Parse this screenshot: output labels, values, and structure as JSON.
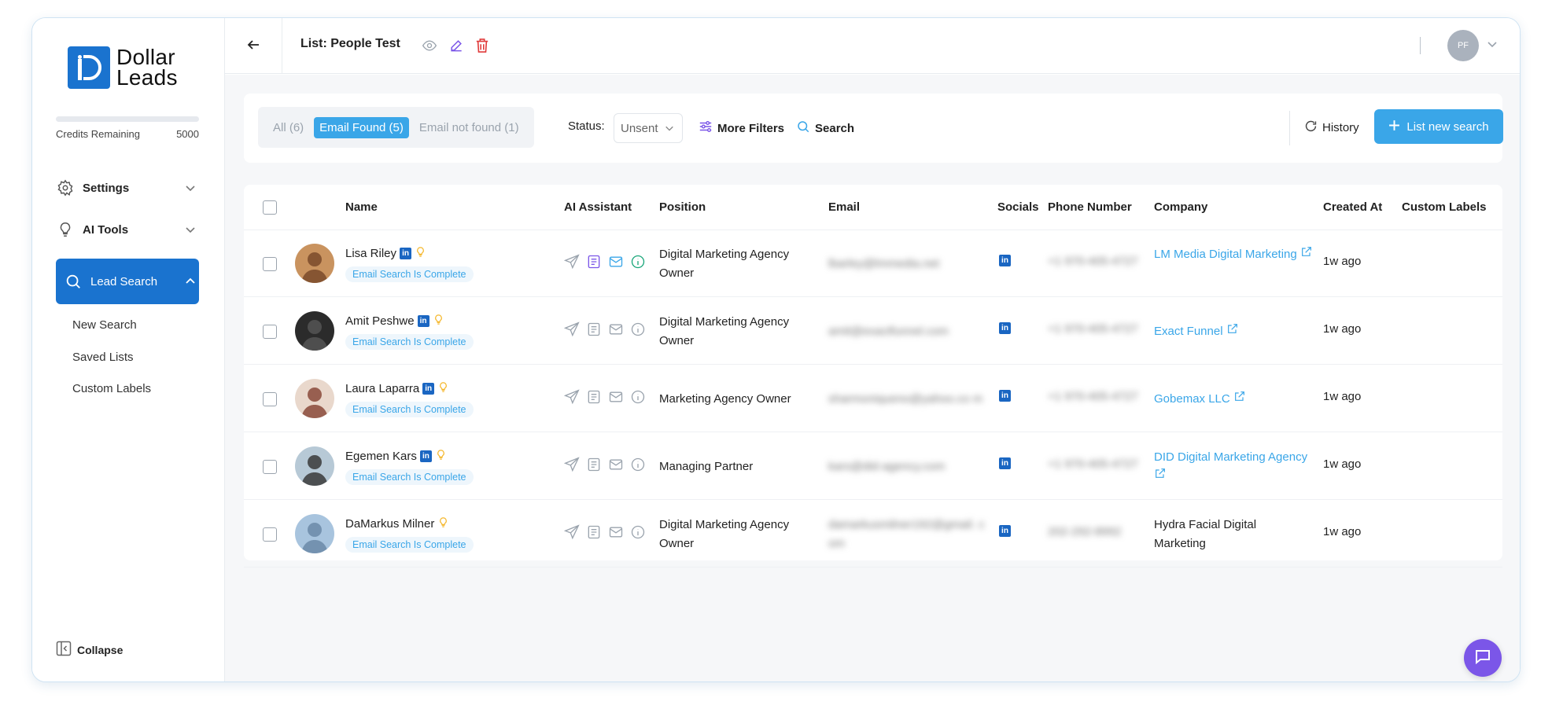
{
  "sidebar": {
    "logo_line1": "Dollar",
    "logo_line2": "Leads",
    "credits_label": "Credits Remaining",
    "credits_value": "5000",
    "settings_label": "Settings",
    "ai_tools_label": "AI Tools",
    "lead_search_label": "Lead Search",
    "sub_items": [
      "New Search",
      "Saved Lists",
      "Custom Labels"
    ],
    "collapse_label": "Collapse"
  },
  "topbar": {
    "title": "List: People Test",
    "avatar_initials": "PF"
  },
  "filters": {
    "tabs": [
      "All (6)",
      "Email Found (5)",
      "Email not found (1)"
    ],
    "active_tab": "Email Found (5)",
    "status_label": "Status:",
    "status_value": "Unsent",
    "more_filters_label": "More Filters",
    "search_label": "Search",
    "history_label": "History",
    "new_search_label": "List new search"
  },
  "table": {
    "columns": [
      "Name",
      "AI Assistant",
      "Position",
      "Email",
      "Socials",
      "Phone Number",
      "Company",
      "Created At",
      "Custom Labels"
    ],
    "rows": [
      {
        "name": "Lisa Riley",
        "has_linkedin": true,
        "status": "Email Search Is Complete",
        "position_line1": "Digital Marketing Agency",
        "position_line2": "Owner",
        "email": "lbarley@lmmedia.net",
        "phone": "+1 970-405-4727",
        "company_line1": "LM Media Digital Marketing",
        "company_line2": "",
        "company_link": true,
        "created": "1w ago"
      },
      {
        "name": "Amit Peshwe",
        "has_linkedin": true,
        "status": "Email Search Is Complete",
        "position_line1": "Digital Marketing Agency",
        "position_line2": "Owner",
        "email": "amit@exactfunnel.com",
        "phone": "+1 970-405-4727",
        "company_line1": "Exact Funnel",
        "company_line2": "",
        "company_link": true,
        "created": "1w ago"
      },
      {
        "name": "Laura Laparra",
        "has_linkedin": true,
        "status": "Email Search Is Complete",
        "position_line1": "Marketing Agency Owner",
        "position_line2": "",
        "email": "sharmoniqueno@yahoo.co m",
        "phone": "+1 970-405-4727",
        "company_line1": "Gobemax LLC",
        "company_line2": "",
        "company_link": true,
        "created": "1w ago"
      },
      {
        "name": "Egemen Kars",
        "has_linkedin": true,
        "status": "Email Search Is Complete",
        "position_line1": "Managing Partner",
        "position_line2": "",
        "email": "kars@did-agency.com",
        "phone": "+1 970-405-4727",
        "company_line1": "DID Digital Marketing Agency",
        "company_line2": "",
        "company_link": true,
        "created": "1w ago"
      },
      {
        "name": "DaMarkus Milner",
        "has_linkedin": false,
        "status": "Email Search Is Complete",
        "position_line1": "Digital Marketing Agency",
        "position_line2": "Owner",
        "email": "damarkusmilner192@gmail. com",
        "phone": "202-292-8992",
        "company_line1": "Hydra Facial Digital",
        "company_line2": "Marketing",
        "company_link": false,
        "created": "1w ago"
      }
    ]
  },
  "colors": {
    "brand_blue": "#1a73cf",
    "accent_blue": "#3aa6e8",
    "linkedin_blue": "#1a66c2",
    "ai_purple": "#7b56e8",
    "ai_green": "#1aa67a",
    "delete_red": "#e03b3b",
    "chat_purple": "#7b56e8"
  }
}
